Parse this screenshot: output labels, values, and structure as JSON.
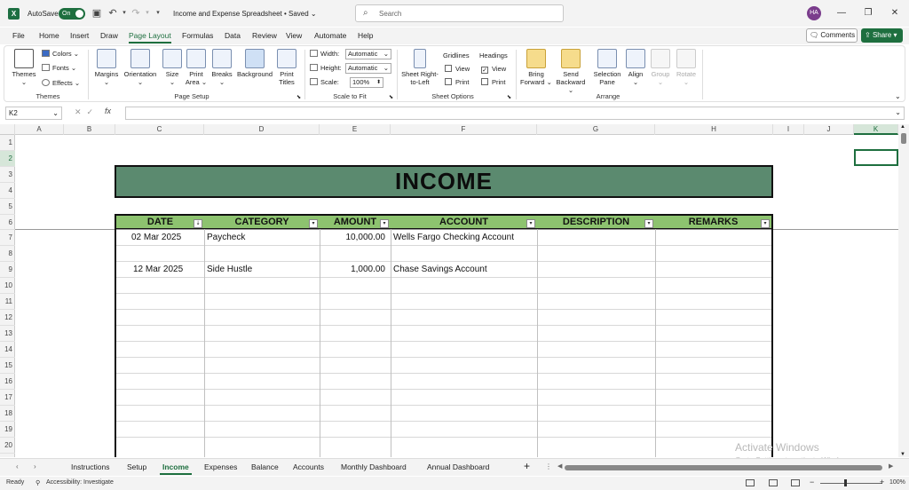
{
  "titlebar": {
    "logo": "X",
    "autosave_label": "AutoSave",
    "autosave_state": "On",
    "doc_title": "Income and Expense Spreadsheet • Saved",
    "search_placeholder": "Search",
    "user_initials": "HA",
    "icons": [
      "save-icon",
      "undo-icon",
      "redo-icon",
      "customize-icon",
      "search-icon",
      "minimize-icon",
      "restore-icon",
      "close-icon"
    ]
  },
  "menu": {
    "tabs": [
      "File",
      "Home",
      "Insert",
      "Draw",
      "Page Layout",
      "Formulas",
      "Data",
      "Review",
      "View",
      "Automate",
      "Help"
    ],
    "active": "Page Layout",
    "comments_label": "Comments",
    "share_label": "Share"
  },
  "ribbon": {
    "themes": {
      "themes": "Themes",
      "colors": "Colors",
      "fonts": "Fonts",
      "effects": "Effects",
      "group": "Themes"
    },
    "page_setup": {
      "margins": "Margins",
      "orientation": "Orientation",
      "size": "Size",
      "print_area": "Print Area",
      "breaks": "Breaks",
      "background": "Background",
      "print_titles": "Print Titles",
      "group": "Page Setup"
    },
    "scale": {
      "width_label": "Width:",
      "width_value": "Automatic",
      "height_label": "Height:",
      "height_value": "Automatic",
      "scale_label": "Scale:",
      "scale_value": "100%",
      "group": "Scale to Fit"
    },
    "sheet_options": {
      "sheet_rtl": "Sheet Right-to-Left",
      "gridlines": "Gridlines",
      "headings": "Headings",
      "view": "View",
      "print": "Print",
      "group": "Sheet Options",
      "gridlines_view": false,
      "gridlines_print": false,
      "headings_view": true,
      "headings_print": false
    },
    "arrange": {
      "bring_forward": "Bring Forward",
      "send_backward": "Send Backward",
      "selection_pane": "Selection Pane",
      "align": "Align",
      "group_btn": "Group",
      "rotate": "Rotate",
      "group": "Arrange"
    }
  },
  "formula": {
    "name_box": "K2",
    "fx": "fx",
    "value": ""
  },
  "columns": [
    "A",
    "B",
    "C",
    "D",
    "E",
    "F",
    "G",
    "H",
    "I",
    "J",
    "K"
  ],
  "rows": [
    "1",
    "2",
    "3",
    "4",
    "5",
    "6",
    "7",
    "8",
    "9",
    "10",
    "11",
    "12",
    "13",
    "14",
    "15",
    "16",
    "17",
    "18",
    "19",
    "20"
  ],
  "sheet": {
    "banner": "INCOME",
    "headers": [
      "DATE",
      "CATEGORY",
      "AMOUNT",
      "ACCOUNT",
      "DESCRIPTION",
      "REMARKS"
    ],
    "records": [
      {
        "date": "02 Mar 2025",
        "category": "Paycheck",
        "amount": "10,000.00",
        "account": "Wells Fargo Checking Account",
        "description": "",
        "remarks": ""
      },
      {
        "date": "12 Mar 2025",
        "category": "Side Hustle",
        "amount": "1,000.00",
        "account": "Chase Savings Account",
        "description": "",
        "remarks": ""
      }
    ]
  },
  "sheet_tabs": [
    "Instructions",
    "Setup",
    "Income",
    "Expenses",
    "Balance",
    "Accounts",
    "Monthly Dashboard",
    "Annual Dashboard"
  ],
  "active_sheet": "Income",
  "status": {
    "ready": "Ready",
    "accessibility": "Accessibility: Investigate",
    "zoom": "100%"
  },
  "watermark": {
    "line1": "Activate Windows",
    "line2": "Go to Settings to activate Windows."
  },
  "colors": {
    "accent": "#1e6f3f",
    "banner": "#5b8a6f",
    "header": "#8dc36f"
  }
}
